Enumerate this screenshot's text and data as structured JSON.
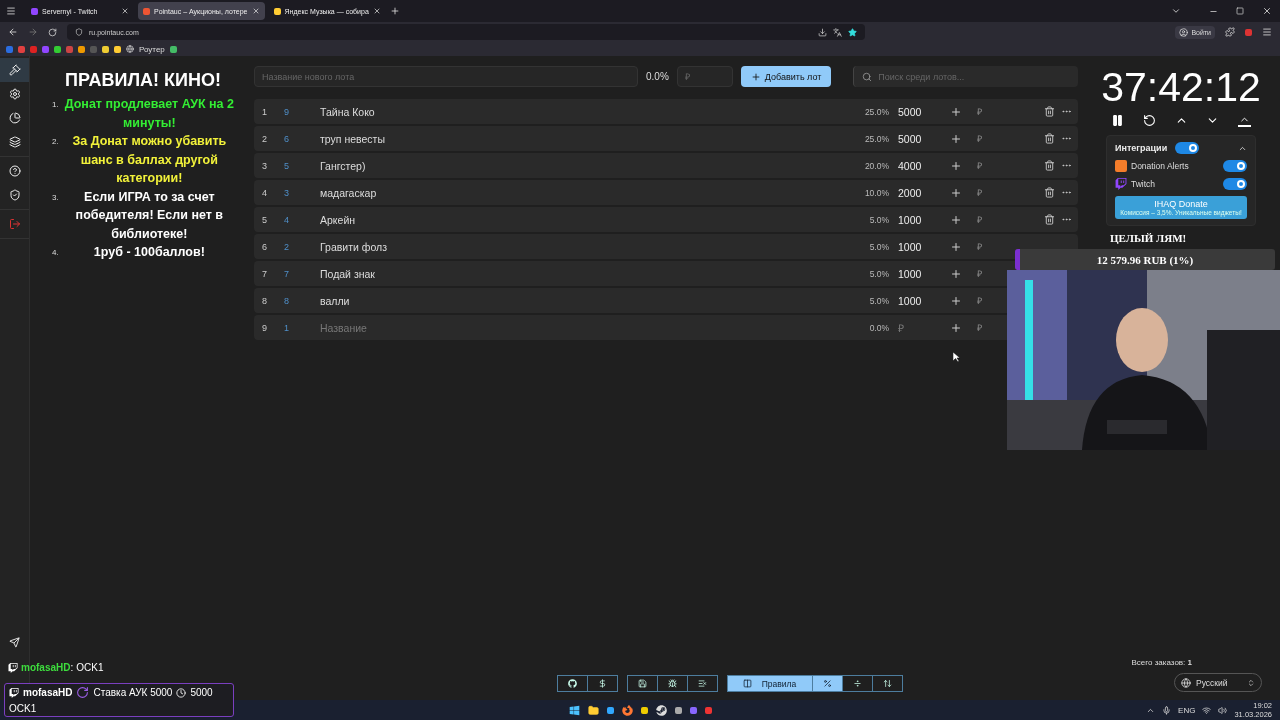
{
  "browser": {
    "tabs": [
      {
        "title": "Servernyi - Twitch",
        "kind": "twitch",
        "selected": false
      },
      {
        "title": "Pointauc – Аукционы, лотере",
        "kind": "pointauc",
        "selected": true
      },
      {
        "title": "Яндекс Музыка — собира",
        "kind": "music",
        "selected": false
      }
    ],
    "url": "ru.pointauc.com",
    "bookmark_label": "Роутер",
    "login": "Войти"
  },
  "sidebar": {
    "sections": [
      {
        "items": [
          {
            "kind": "gavel",
            "selected": true
          },
          {
            "kind": "settings",
            "selected": false
          },
          {
            "kind": "pie",
            "selected": false
          },
          {
            "kind": "layers",
            "selected": false
          }
        ]
      },
      {
        "items": [
          {
            "kind": "help",
            "selected": false
          },
          {
            "kind": "shield",
            "selected": false
          }
        ]
      },
      {
        "items": [
          {
            "kind": "logout",
            "selected": false
          }
        ]
      }
    ]
  },
  "rules": {
    "title": "ПРАВИЛА! КИНО!",
    "items": [
      {
        "number": "1.",
        "text": "Донат продлевает АУК на 2 минуты!",
        "color": "#33ee33"
      },
      {
        "number": "2.",
        "text": "За Донат можно убавить шанс в баллах другой категории!",
        "color": "#f2f23a"
      },
      {
        "number": "3.",
        "text": "Если ИГРА то за счет победителя! Если нет в библиотеке!",
        "color": "#ffffff"
      },
      {
        "number": "4.",
        "text": "1руб - 100баллов!",
        "color": "#ffffff"
      }
    ]
  },
  "lot_form": {
    "name_placeholder": "Название нового лота",
    "percent": "0.0%",
    "amount_placeholder": "₽",
    "add_button": "Добавить лот",
    "search_placeholder": "Поиск среди лотов..."
  },
  "lots": [
    {
      "kind": "lot",
      "index": "1",
      "id": "9",
      "name": "Тайна Коко",
      "percent": "25.0%",
      "amount": "5000",
      "currency": "₽",
      "actions": true
    },
    {
      "kind": "lot",
      "index": "2",
      "id": "6",
      "name": "труп невесты",
      "percent": "25.0%",
      "amount": "5000",
      "currency": "₽",
      "actions": true
    },
    {
      "kind": "lot",
      "index": "3",
      "id": "5",
      "name": "Гангстер)",
      "percent": "20.0%",
      "amount": "4000",
      "currency": "₽",
      "actions": true
    },
    {
      "kind": "lot",
      "index": "4",
      "id": "3",
      "name": "мадагаскар",
      "percent": "10.0%",
      "amount": "2000",
      "currency": "₽",
      "actions": true
    },
    {
      "kind": "lot",
      "index": "5",
      "id": "4",
      "name": "Аркейн",
      "percent": "5.0%",
      "amount": "1000",
      "currency": "₽",
      "actions": true
    },
    {
      "kind": "lot",
      "index": "6",
      "id": "2",
      "name": "Гравити фолз",
      "percent": "5.0%",
      "amount": "1000",
      "currency": "₽",
      "actions": false
    },
    {
      "kind": "lot",
      "index": "7",
      "id": "7",
      "name": "Подай знак",
      "percent": "5.0%",
      "amount": "1000",
      "currency": "₽"
    },
    {
      "kind": "lot",
      "index": "8",
      "id": "8",
      "name": "валли",
      "percent": "5.0%",
      "amount": "1000",
      "currency": "₽"
    },
    {
      "kind": "draft",
      "index": "9",
      "id": "1",
      "name_placeholder": "Название",
      "percent": "0.0%",
      "amount_placeholder": "₽",
      "currency": "₽"
    }
  ],
  "timer": {
    "time": "37:42:12"
  },
  "integrations": {
    "title": "Интеграции",
    "on": true,
    "expanded": true,
    "items": [
      {
        "name": "Donation Alerts",
        "kind": "donationalerts",
        "on": true
      },
      {
        "name": "Twitch",
        "kind": "twitch",
        "on": true
      }
    ],
    "promo": {
      "title": "IHAQ Donate",
      "subtitle": "Комиссия – 3,5%. Уникальные виджеты!"
    }
  },
  "goal": {
    "title": "ЦЕЛЫЙ ЛЯМ!",
    "reading": "12 579.96 RUB (1%)",
    "level": 0.02
  },
  "chat": {
    "message": {
      "user": "mofasaHD",
      "separator": ":",
      "text": "OCK1"
    },
    "redemption": {
      "user": "mofasaHD",
      "reward": "Ставка АУК 5000",
      "cost": "5000",
      "text": "OCK1"
    }
  },
  "footer": {
    "orders_label": "Всего заказов:",
    "orders": "1",
    "language": "Русский",
    "groups": [
      {
        "buttons": [
          {
            "kind": "github",
            "selected": false
          },
          {
            "kind": "dollar",
            "selected": false
          }
        ]
      },
      {
        "buttons": [
          {
            "kind": "save",
            "selected": false
          },
          {
            "kind": "bug",
            "selected": false
          },
          {
            "kind": "clear",
            "selected": false
          }
        ]
      },
      {
        "buttons": [
          {
            "kind": "rules",
            "label": "Правила",
            "selected": true
          },
          {
            "kind": "percent",
            "selected": true
          },
          {
            "kind": "divide",
            "selected": false
          },
          {
            "kind": "sort",
            "selected": false
          }
        ]
      }
    ]
  },
  "taskbar": {
    "language": "ENG",
    "time": "19:02",
    "date": "31.03.2026"
  }
}
